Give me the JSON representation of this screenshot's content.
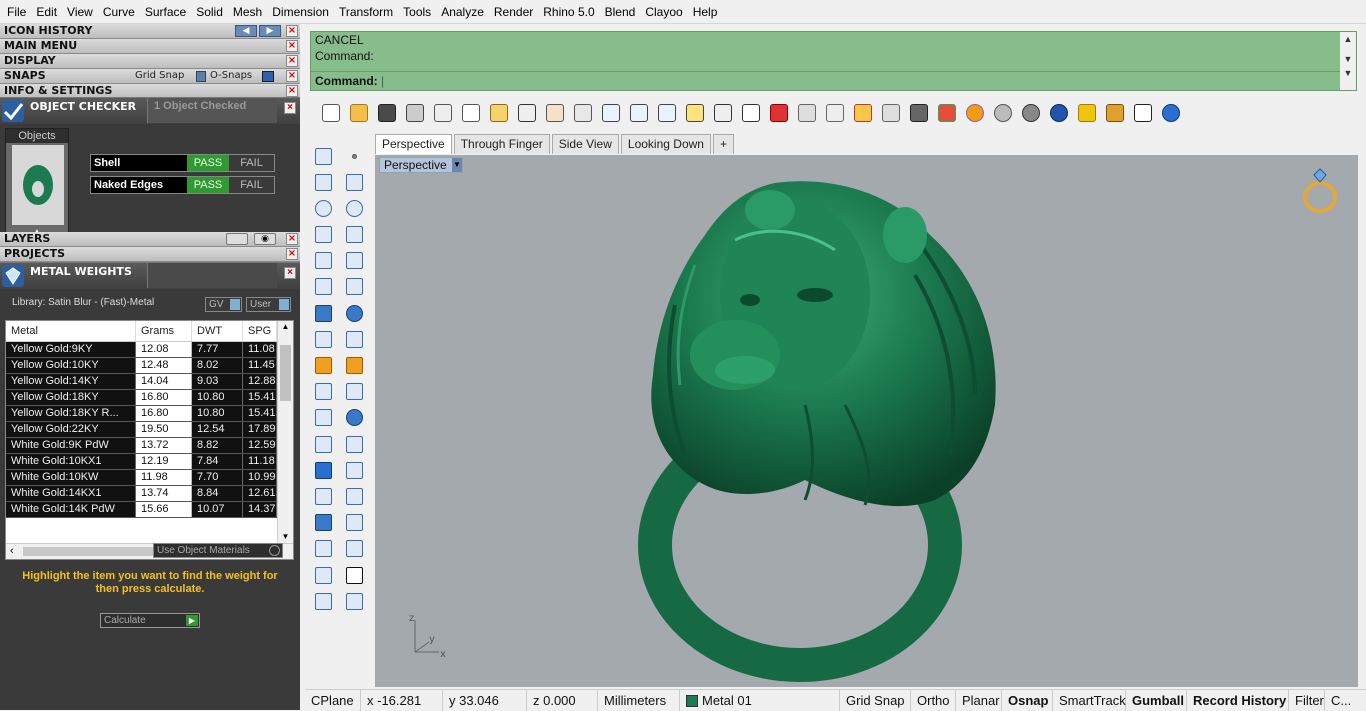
{
  "menu": [
    "File",
    "Edit",
    "View",
    "Curve",
    "Surface",
    "Solid",
    "Mesh",
    "Dimension",
    "Transform",
    "Tools",
    "Analyze",
    "Render",
    "Rhino 5.0",
    "Blend",
    "Clayoo",
    "Help"
  ],
  "panels": {
    "icon_history": "ICON HISTORY",
    "main_menu": "MAIN MENU",
    "display": "DISPLAY",
    "snaps": "SNAPS",
    "grid_snap": "Grid Snap",
    "o_snaps": "O-Snaps",
    "info_settings": "INFO & SETTINGS",
    "layers": "LAYERS",
    "projects": "PROJECTS"
  },
  "object_checker": {
    "title": "OBJECT CHECKER",
    "status": "1 Object Checked",
    "objects_tab": "Objects",
    "rows": [
      {
        "label": "Shell",
        "pass": "PASS",
        "fail": "FAIL"
      },
      {
        "label": "Naked Edges",
        "pass": "PASS",
        "fail": "FAIL"
      }
    ]
  },
  "metal_weights": {
    "title": "METAL WEIGHTS",
    "library": "Library: Satin Blur - (Fast)-Metal",
    "gv": "GV",
    "user": "User",
    "headers": [
      "Metal",
      "Grams",
      "DWT",
      "SPG"
    ],
    "rows": [
      [
        "Yellow Gold:9KY",
        "12.08",
        "7.77",
        "11.08"
      ],
      [
        "Yellow Gold:10KY",
        "12.48",
        "8.02",
        "11.45"
      ],
      [
        "Yellow Gold:14KY",
        "14.04",
        "9.03",
        "12.88"
      ],
      [
        "Yellow Gold:18KY",
        "16.80",
        "10.80",
        "15.41"
      ],
      [
        "Yellow Gold:18KY R...",
        "16.80",
        "10.80",
        "15.41"
      ],
      [
        "Yellow Gold:22KY",
        "19.50",
        "12.54",
        "17.89"
      ],
      [
        "White Gold:9K PdW",
        "13.72",
        "8.82",
        "12.59"
      ],
      [
        "White Gold:10KX1",
        "12.19",
        "7.84",
        "11.18"
      ],
      [
        "White Gold:10KW",
        "11.98",
        "7.70",
        "10.99"
      ],
      [
        "White Gold:14KX1",
        "13.74",
        "8.84",
        "12.61"
      ],
      [
        "White Gold:14K PdW",
        "15.66",
        "10.07",
        "14.37"
      ]
    ],
    "use_object_materials": "Use Object Materials",
    "hint": "Highlight the item you want to find the weight for then press calculate.",
    "calculate": "Calculate"
  },
  "command": {
    "line1": "CANCEL",
    "line2": "Command:",
    "prompt": "Command:"
  },
  "viewport_tabs": [
    "Perspective",
    "Through Finger",
    "Side View",
    "Looking Down",
    "+"
  ],
  "viewport_label": "Perspective",
  "status": {
    "cplane": "CPlane",
    "x": "x -16.281",
    "y": "y 33.046",
    "z": "z 0.000",
    "units": "Millimeters",
    "layer": "Metal 01",
    "toggles": [
      "Grid Snap",
      "Ortho",
      "Planar",
      "Osnap",
      "SmartTrack",
      "Gumball",
      "Record History",
      "Filter",
      "C..."
    ],
    "bold_toggles": [
      "Osnap",
      "Gumball",
      "Record History"
    ]
  },
  "colors": {
    "model_green": "#1b7a4e",
    "command_bg": "#87bd8b",
    "pass_green": "#2f9a2f",
    "hint_yellow": "#f4c020"
  }
}
